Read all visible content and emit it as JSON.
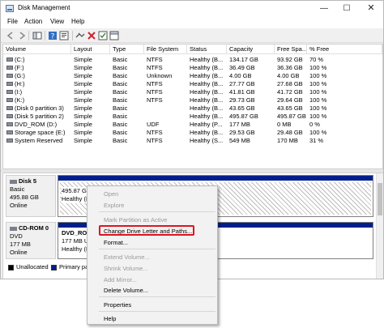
{
  "window": {
    "title": "Disk Management",
    "minimize": "—",
    "maximize": "☐",
    "close": "✕"
  },
  "menu": [
    "File",
    "Action",
    "View",
    "Help"
  ],
  "columns": [
    "Volume",
    "Layout",
    "Type",
    "File System",
    "Status",
    "Capacity",
    "Free Spa...",
    "% Free"
  ],
  "volumes": [
    {
      "volume": "(C:)",
      "layout": "Simple",
      "type": "Basic",
      "fs": "NTFS",
      "status": "Healthy (B...",
      "capacity": "134.17 GB",
      "free": "93.92 GB",
      "pct": "70 %"
    },
    {
      "volume": "(F:)",
      "layout": "Simple",
      "type": "Basic",
      "fs": "NTFS",
      "status": "Healthy (B...",
      "capacity": "36.49 GB",
      "free": "36.36 GB",
      "pct": "100 %"
    },
    {
      "volume": "(G:)",
      "layout": "Simple",
      "type": "Basic",
      "fs": "Unknown",
      "status": "Healthy (B...",
      "capacity": "4.00 GB",
      "free": "4.00 GB",
      "pct": "100 %"
    },
    {
      "volume": "(H:)",
      "layout": "Simple",
      "type": "Basic",
      "fs": "NTFS",
      "status": "Healthy (B...",
      "capacity": "27.77 GB",
      "free": "27.68 GB",
      "pct": "100 %"
    },
    {
      "volume": "(I:)",
      "layout": "Simple",
      "type": "Basic",
      "fs": "NTFS",
      "status": "Healthy (B...",
      "capacity": "41.81 GB",
      "free": "41.72 GB",
      "pct": "100 %"
    },
    {
      "volume": "(K:)",
      "layout": "Simple",
      "type": "Basic",
      "fs": "NTFS",
      "status": "Healthy (B...",
      "capacity": "29.73 GB",
      "free": "29.64 GB",
      "pct": "100 %"
    },
    {
      "volume": "(Disk 0 partition 3)",
      "layout": "Simple",
      "type": "Basic",
      "fs": "",
      "status": "Healthy (B...",
      "capacity": "43.65 GB",
      "free": "43.65 GB",
      "pct": "100 %"
    },
    {
      "volume": "(Disk 5 partition 2)",
      "layout": "Simple",
      "type": "Basic",
      "fs": "",
      "status": "Healthy (B...",
      "capacity": "495.87 GB",
      "free": "495.87 GB",
      "pct": "100 %"
    },
    {
      "volume": "DVD_ROM (D:)",
      "layout": "Simple",
      "type": "Basic",
      "fs": "UDF",
      "status": "Healthy (P...",
      "capacity": "177 MB",
      "free": "0 MB",
      "pct": "0 %"
    },
    {
      "volume": "Storage space (E:)",
      "layout": "Simple",
      "type": "Basic",
      "fs": "NTFS",
      "status": "Healthy (B...",
      "capacity": "29.53 GB",
      "free": "29.48 GB",
      "pct": "100 %"
    },
    {
      "volume": "System Reserved",
      "layout": "Simple",
      "type": "Basic",
      "fs": "NTFS",
      "status": "Healthy (S...",
      "capacity": "549 MB",
      "free": "170 MB",
      "pct": "31 %"
    }
  ],
  "disks": {
    "disk5": {
      "name": "Disk 5",
      "type": "Basic",
      "size": "495.88 GB",
      "state": "Online",
      "partition": {
        "size": "495.87 GB",
        "status": "Healthy (P"
      }
    },
    "cdrom0": {
      "name": "CD-ROM 0",
      "type": "DVD",
      "size": "177 MB",
      "state": "Online",
      "partition": {
        "name": "DVD_ROM",
        "size": "177 MB UDF",
        "status": "Healthy (P"
      }
    }
  },
  "legend": {
    "unallocated": "Unallocated",
    "primary": "Primary par",
    "primary_color": "#001f8c"
  },
  "context_menu": {
    "items": [
      {
        "label": "Open",
        "enabled": false
      },
      {
        "label": "Explore",
        "enabled": false
      },
      {
        "label": "Mark Partition as Active",
        "enabled": false
      },
      {
        "label": "Change Drive Letter and Paths...",
        "enabled": true
      },
      {
        "label": "Format...",
        "enabled": true
      },
      {
        "label": "Extend Volume...",
        "enabled": false
      },
      {
        "label": "Shrink Volume...",
        "enabled": false
      },
      {
        "label": "Add Mirror...",
        "enabled": false
      },
      {
        "label": "Delete Volume...",
        "enabled": true
      },
      {
        "label": "Properties",
        "enabled": true
      },
      {
        "label": "Help",
        "enabled": true
      }
    ],
    "highlight_color": "#e0131f"
  },
  "icons": [
    "back-icon",
    "forward-icon",
    "console-tree-icon",
    "help-icon",
    "properties-icon",
    "connect-icon",
    "delete-icon",
    "check-icon",
    "show-hide-icon"
  ]
}
